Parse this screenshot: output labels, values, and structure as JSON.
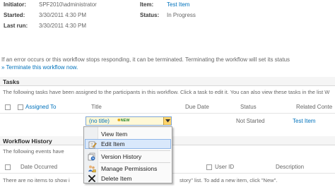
{
  "summary": {
    "initiator_label": "Initiator:",
    "initiator_value": "SPF2010\\administrator",
    "started_label": "Started:",
    "started_value": "3/30/2011 4:30 PM",
    "last_run_label": "Last run:",
    "last_run_value": "3/30/2011 4:30 PM",
    "item_label": "Item:",
    "item_value": "Test Item",
    "status_label": "Status:",
    "status_value": "In Progress"
  },
  "error_note": "If an error occurs or this workflow stops responding, it can be terminated. Terminating the workflow will set its status",
  "terminate_link": "Terminate this workflow now.",
  "tasks": {
    "title": "Tasks",
    "description": "The following tasks have been assigned to the participants in this workflow. Click a task to edit it. You can also view these tasks in the list W",
    "columns": [
      "Assigned To",
      "Title",
      "Due Date",
      "Status",
      "Related Conte"
    ],
    "row": {
      "title": "(no title)",
      "new_badge": "NEW",
      "status": "Not Started",
      "related": "Test Item"
    }
  },
  "history": {
    "title": "Workflow History",
    "description": "The following events have",
    "columns": [
      "Date Occurred",
      "User ID",
      "Description"
    ],
    "empty_left": "There are no items to show i",
    "empty_right": "story\" list. To add a new item, click \"New\"."
  },
  "context_menu": {
    "items": [
      {
        "label": "View Item",
        "icon": "blank"
      },
      {
        "label": "Edit Item",
        "icon": "edit-icon"
      },
      {
        "label": "Version History",
        "icon": "version-history-icon"
      },
      {
        "label": "Manage Permissions",
        "icon": "permissions-icon"
      },
      {
        "label": "Delete Item",
        "icon": "delete-icon"
      }
    ]
  }
}
